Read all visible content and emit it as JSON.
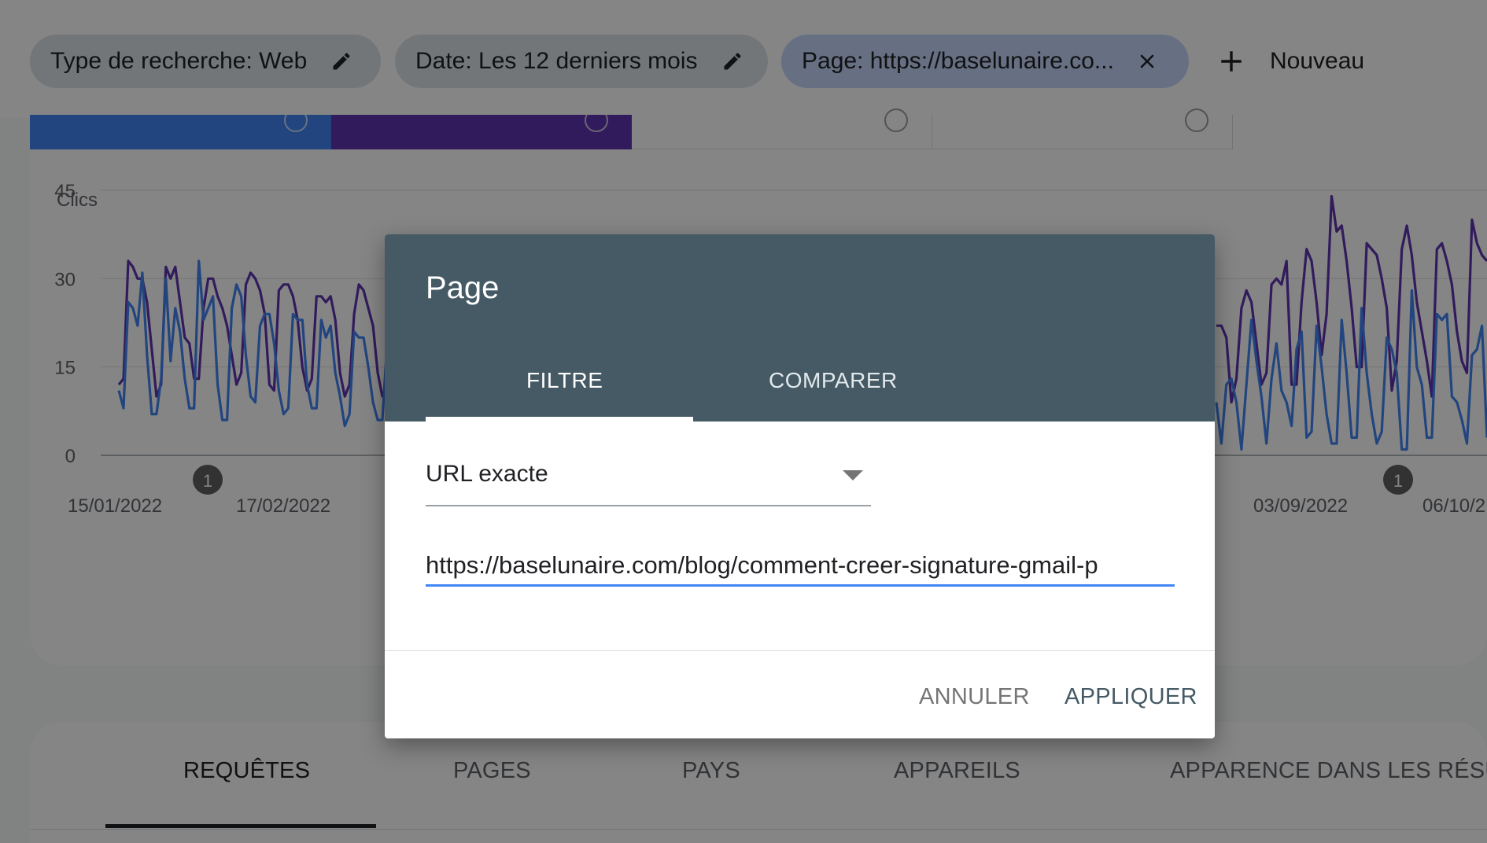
{
  "filters": {
    "search_type": "Type de recherche: Web",
    "date": "Date: Les 12 derniers mois",
    "page": "Page: https://baselunaire.co...",
    "new_label": "Nouveau"
  },
  "chart": {
    "ylabel": "Clics",
    "yticks": [
      "45",
      "30",
      "15",
      "0"
    ],
    "xticks": [
      "15/01/2022",
      "17/02/2022",
      "03/09/2022",
      "06/10/2"
    ],
    "annotation": "1"
  },
  "chart_data": {
    "type": "line",
    "title": "",
    "xlabel": "",
    "ylabel": "Clics",
    "ylim": [
      0,
      45
    ],
    "grid": true,
    "legend": "none",
    "x_ticks": [
      "15/01/2022",
      "17/02/2022",
      "03/09/2022",
      "06/10/2"
    ],
    "series": [
      {
        "color": "#5e35b1",
        "segment_left_values": [
          12,
          13,
          33,
          32,
          30,
          30,
          26,
          18,
          10,
          12,
          32,
          30,
          32,
          26,
          20,
          19,
          13,
          13,
          25,
          30,
          30,
          27,
          25,
          22,
          17,
          12,
          14,
          29,
          31,
          30,
          28,
          24,
          12,
          11,
          28,
          29,
          29,
          27,
          23,
          15,
          11,
          13,
          27,
          27,
          26,
          27,
          23,
          14,
          10,
          12,
          24,
          29,
          28,
          25,
          22,
          14,
          10,
          12,
          25
        ],
        "segment_right_values": [
          22,
          22,
          20,
          9,
          13,
          25,
          28,
          26,
          19,
          12,
          14,
          29,
          30,
          29,
          33,
          12,
          12,
          26,
          35,
          33,
          26,
          17,
          24,
          44,
          38,
          39,
          33,
          25,
          15,
          15,
          36,
          35,
          34,
          30,
          25,
          11,
          16,
          35,
          39,
          34,
          26,
          21,
          16,
          10,
          35,
          36,
          33,
          29,
          21,
          16,
          14,
          40,
          36,
          34,
          33
        ]
      },
      {
        "color": "#4285f4",
        "segment_left_values": [
          11,
          8,
          26,
          25,
          22,
          31,
          17,
          7,
          7,
          13,
          30,
          16,
          25,
          21,
          13,
          8,
          8,
          33,
          23,
          25,
          27,
          12,
          6,
          6,
          25,
          29,
          27,
          17,
          10,
          9,
          22,
          24,
          24,
          19,
          11,
          7,
          8,
          24,
          23,
          23,
          12,
          8,
          8,
          23,
          20,
          22,
          14,
          10,
          5,
          7,
          21,
          20,
          20,
          15,
          9,
          6,
          6,
          19,
          19
        ],
        "segment_right_values": [
          9,
          2,
          12,
          13,
          9,
          1,
          12,
          23,
          16,
          10,
          2,
          13,
          19,
          11,
          9,
          5,
          18,
          21,
          3,
          4,
          22,
          15,
          7,
          2,
          2,
          23,
          14,
          3,
          3,
          25,
          14,
          7,
          2,
          4,
          20,
          18,
          14,
          1,
          1,
          28,
          15,
          12,
          3,
          3,
          24,
          23,
          24,
          10,
          9,
          6,
          2,
          17,
          18,
          22,
          3
        ]
      }
    ]
  },
  "dialog": {
    "title": "Page",
    "tabs": [
      "FILTRE",
      "COMPARER"
    ],
    "match_type": "URL exacte",
    "url_value": "https://baselunaire.com/blog/comment-creer-signature-gmail-p",
    "cancel": "ANNULER",
    "apply": "APPLIQUER"
  },
  "report_tabs": [
    "REQUÊTES",
    "PAGES",
    "PAYS",
    "APPAREILS",
    "APPARENCE DANS LES RÉSUL"
  ],
  "colors": {
    "clicks": "#4285f4",
    "impressions": "#5e35b1",
    "dialog_header": "#455a64",
    "active_chip": "#c4d6f9",
    "input_focus": "#4285f4"
  }
}
